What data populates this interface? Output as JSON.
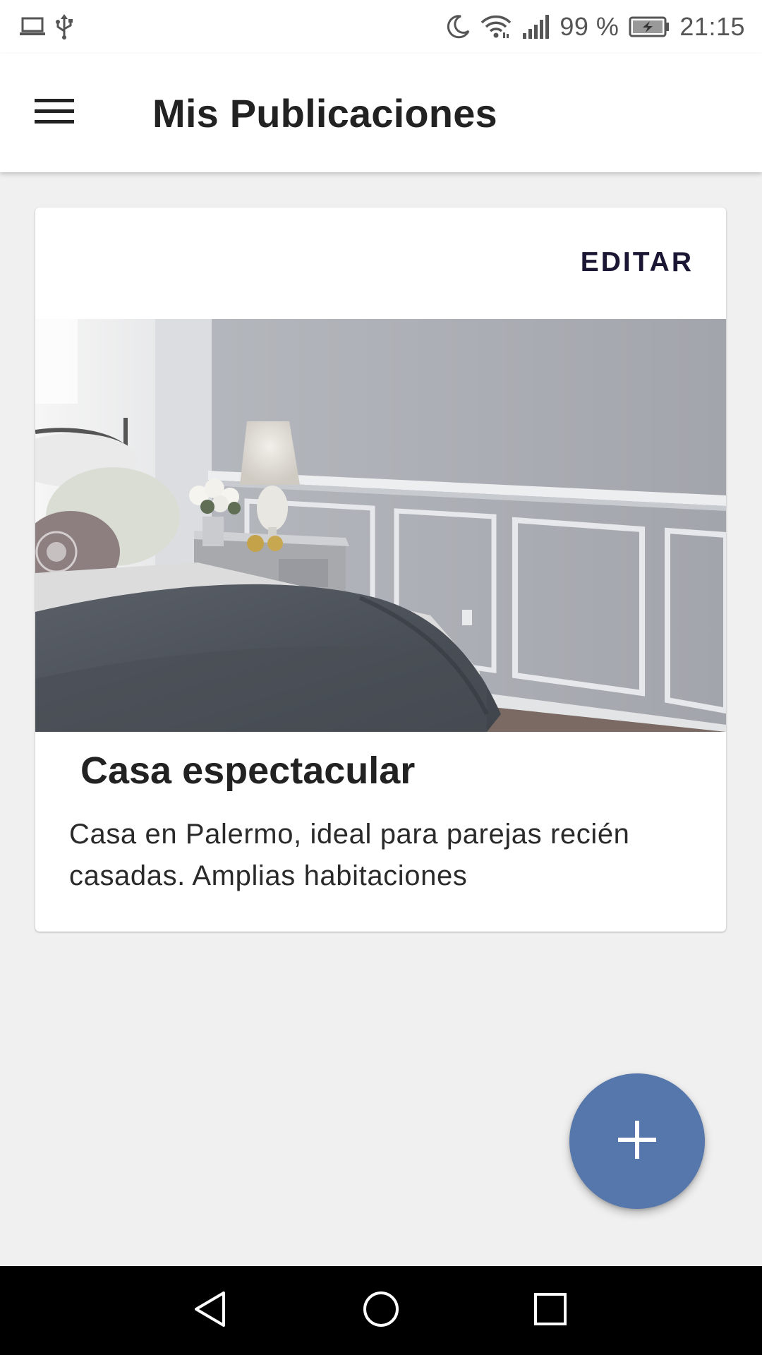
{
  "status_bar": {
    "battery_percent": "99 %",
    "time": "21:15",
    "icons": [
      "laptop-icon",
      "usb-icon",
      "moon-icon",
      "wifi-icon",
      "signal-icon",
      "battery-charging-icon"
    ]
  },
  "app_bar": {
    "title": "Mis Publicaciones",
    "menu_icon": "hamburger-menu-icon"
  },
  "publications": [
    {
      "edit_label": "EDITAR",
      "image": "bedroom-photo",
      "title": "Casa espectacular",
      "description": "Casa en Palermo, ideal para parejas recién casadas. Amplias habitaciones"
    }
  ],
  "fab": {
    "icon": "plus-icon",
    "color": "#5677ac"
  },
  "nav_bar": {
    "icons": [
      "back-triangle-icon",
      "home-circle-icon",
      "recents-square-icon"
    ]
  }
}
